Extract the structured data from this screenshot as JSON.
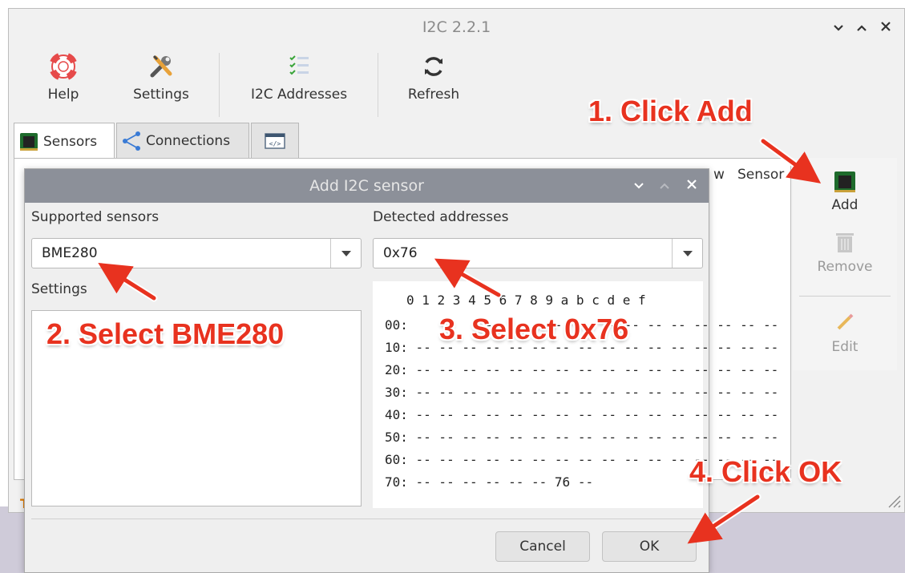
{
  "window": {
    "title": "I2C 2.2.1",
    "controls": {
      "minimize": "⌄",
      "maximize": "⌃",
      "close": "✕"
    }
  },
  "toolbar": {
    "help_label": "Help",
    "settings_label": "Settings",
    "i2c_addresses_label": "I2C Addresses",
    "refresh_label": "Refresh"
  },
  "tabs": [
    {
      "label": "Sensors",
      "icon": "chip-icon"
    },
    {
      "label": "Connections",
      "icon": "share-icon"
    },
    {
      "label": "",
      "icon": "code-icon"
    }
  ],
  "table": {
    "headers": [
      "w",
      "Sensor"
    ]
  },
  "side_panel": {
    "add_label": "Add",
    "remove_label": "Remove",
    "edit_label": "Edit"
  },
  "status": {
    "indicator": "T"
  },
  "dialog": {
    "title": "Add I2C sensor",
    "supported_sensors_label": "Supported sensors",
    "supported_sensor_value": "BME280",
    "detected_addresses_label": "Detected addresses",
    "detected_address_value": "0x76",
    "settings_label": "Settings",
    "grid_header": "0 1 2 3 4 5 6 7 8 9 a b c d e f",
    "grid_rows": [
      "00:          -- -- -- -- -- -- -- -- -- -- -- -- --",
      "10: -- -- -- -- -- -- -- -- -- -- -- -- -- -- -- --",
      "20: -- -- -- -- -- -- -- -- -- -- -- -- -- -- -- --",
      "30: -- -- -- -- -- -- -- -- -- -- -- -- -- -- -- --",
      "40: -- -- -- -- -- -- -- -- -- -- -- -- -- -- -- --",
      "50: -- -- -- -- -- -- -- -- -- -- -- -- -- -- -- --",
      "60: -- -- -- -- -- -- -- -- -- -- -- -- -- -- -- --",
      "70: -- -- -- -- -- -- 76 --"
    ],
    "cancel_label": "Cancel",
    "ok_label": "OK"
  },
  "annotations": {
    "step1": "1. Click Add",
    "step2": "2. Select BME280",
    "step3": "3. Select 0x76",
    "step4": "4. Click OK"
  },
  "colors": {
    "annotation": "#e8321f",
    "dialog_title_bar": "#8c9099",
    "status_indicator": "#e07b00"
  }
}
